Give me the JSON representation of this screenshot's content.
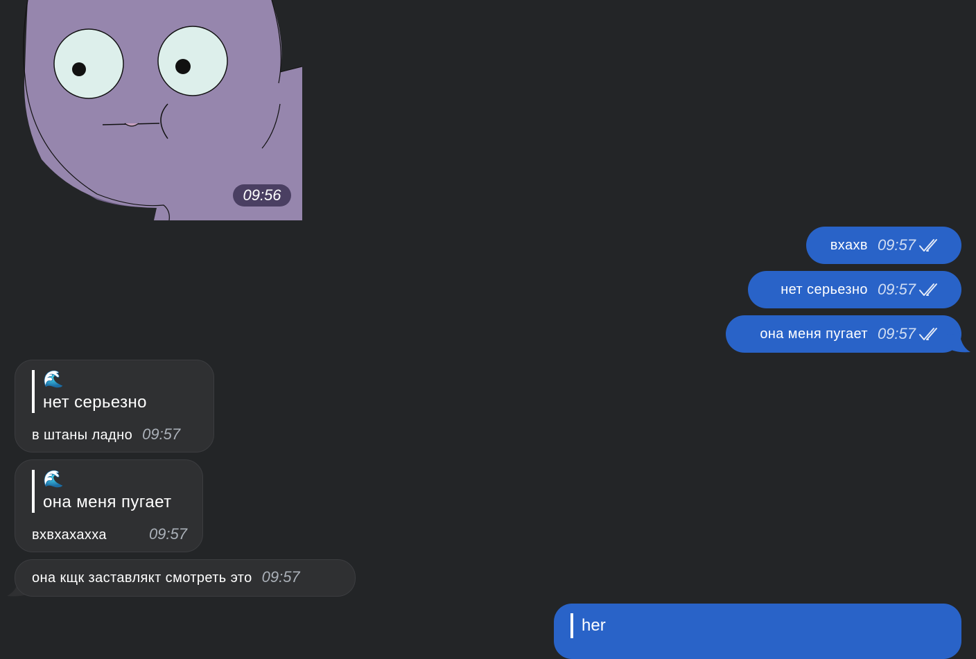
{
  "sticker": {
    "time": "09:56",
    "colors": {
      "body": "#9686ad",
      "shadow": "#6e5f86",
      "eye": "#ddefeb"
    }
  },
  "outgoing": [
    {
      "text": "вхахв",
      "time": "09:57",
      "status_icon": "double-check-icon"
    },
    {
      "text": "нет серьезно",
      "time": "09:57",
      "status_icon": "double-check-icon"
    },
    {
      "text": "она меня пугает",
      "time": "09:57",
      "status_icon": "double-check-icon"
    }
  ],
  "incoming": [
    {
      "reply_emoji": "🌊",
      "reply_text": "нет серьезно",
      "text": "в штаны ладно",
      "time": "09:57"
    },
    {
      "reply_emoji": "🌊",
      "reply_text": "она меня пугает",
      "text": "вхвхахахха",
      "time": "09:57"
    },
    {
      "text": "она кщк заставлякт смотреть это",
      "time": "09:57"
    }
  ],
  "draft": {
    "reply_text": "her"
  },
  "colors": {
    "background": "#232527",
    "outgoing_bubble": "#2963c8",
    "incoming_bubble": "#2f3032"
  }
}
